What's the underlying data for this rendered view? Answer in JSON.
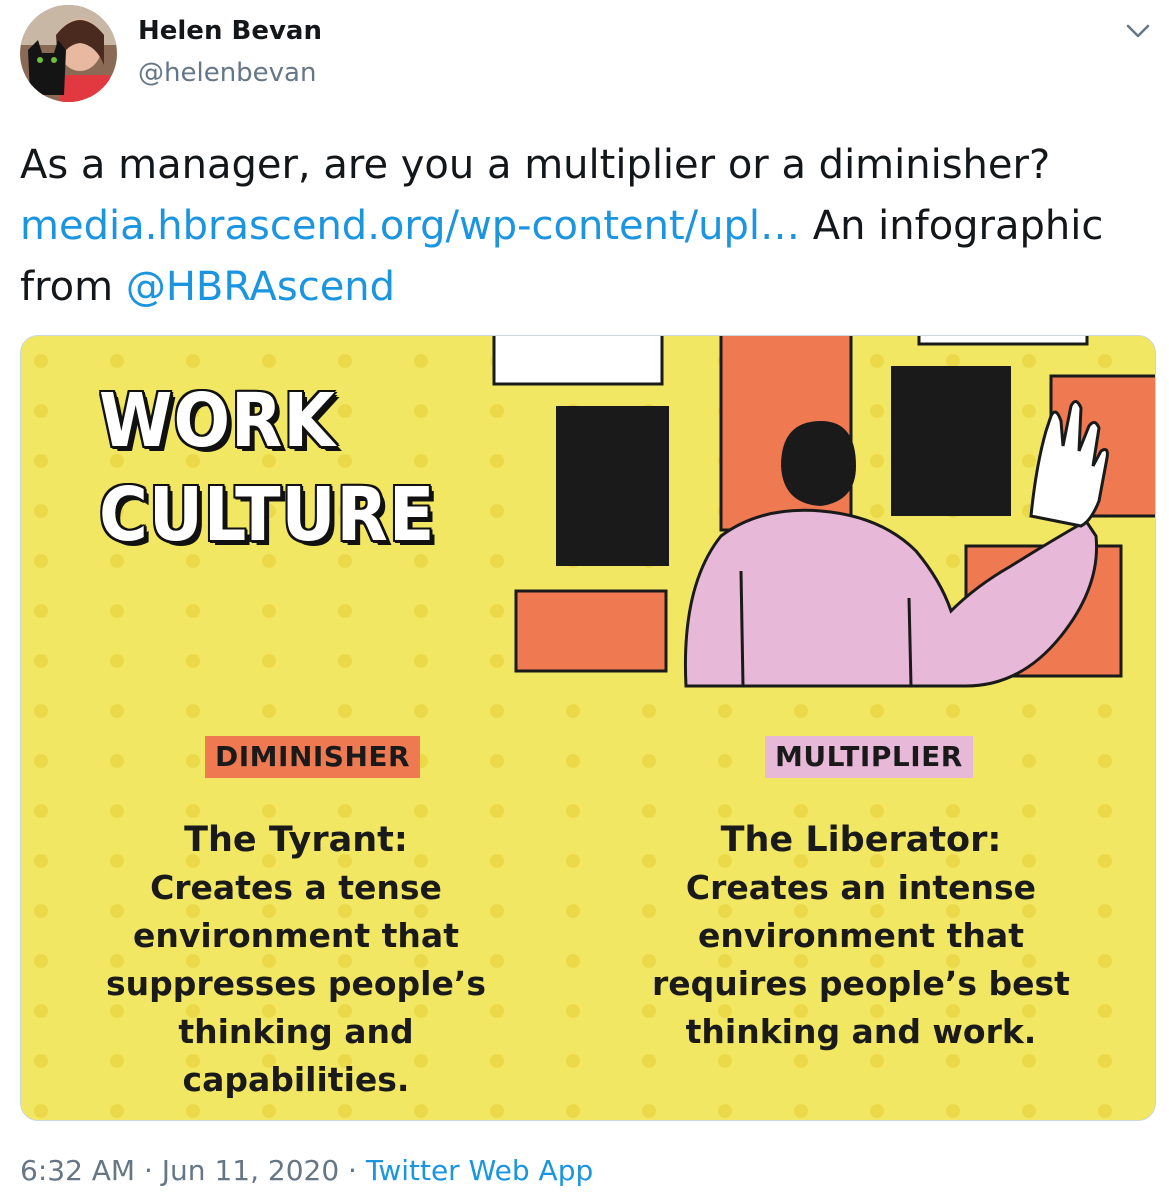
{
  "author": {
    "name": "Helen Bevan",
    "handle": "@helenbevan"
  },
  "tweet": {
    "text_1": "As a manager, are you a multiplier or a diminisher?",
    "link": "media.hbrascend.org/wp-content/upl…",
    "text_2": " An infographic from ",
    "mention": "@HBRAscend"
  },
  "infographic": {
    "headline_line1": "WORK",
    "headline_line2": "CULTURE",
    "left": {
      "tag": "DIMINISHER",
      "title": "The Tyrant:",
      "lines": [
        "Creates a tense",
        "environment that",
        "suppresses people’s",
        "thinking and",
        "capabilities."
      ]
    },
    "right": {
      "tag": "MULTIPLIER",
      "title": "The Liberator:",
      "lines": [
        "Creates an intense",
        "environment that",
        "requires people’s best",
        "thinking and work."
      ]
    },
    "colors": {
      "background": "#f1e763",
      "orange": "#ef7a52",
      "pink": "#e7b8d8",
      "black": "#1a1a1a"
    }
  },
  "footer": {
    "time": "6:32 AM",
    "date": "Jun 11, 2020",
    "separator": " · ",
    "app": "Twitter Web App"
  },
  "icons": {
    "menu": "chevron-down-icon"
  }
}
